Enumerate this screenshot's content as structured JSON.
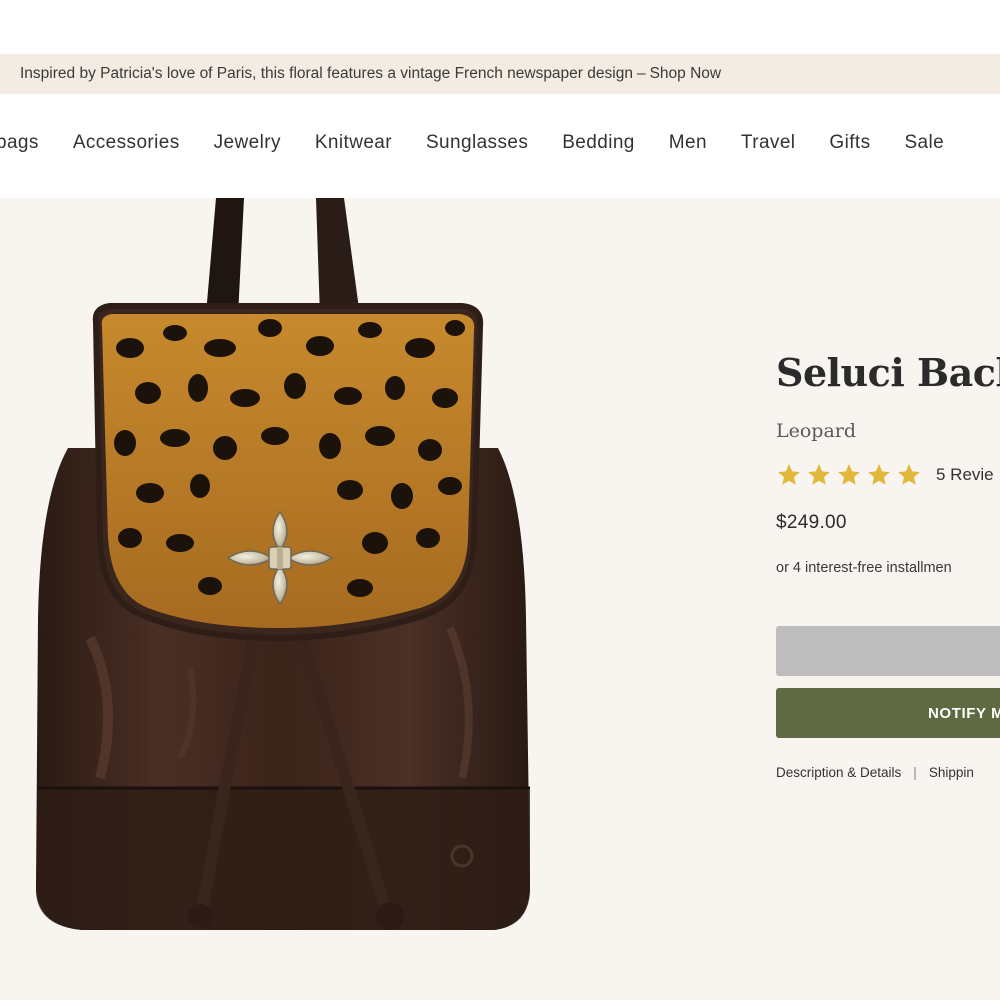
{
  "promo": {
    "text": "Inspired by Patricia's love of Paris, this floral features a vintage French newspaper design",
    "separator": "–",
    "link": "Shop Now"
  },
  "nav": {
    "items": [
      "bags",
      "Accessories",
      "Jewelry",
      "Knitwear",
      "Sunglasses",
      "Bedding",
      "Men",
      "Travel",
      "Gifts",
      "Sale"
    ]
  },
  "product": {
    "title": "Seluci Backpa",
    "variant": "Leopard",
    "rating": 5,
    "rating_max": 5,
    "review_label": "5 Revie",
    "price": "$249.00",
    "installments": "or 4 interest-free installmen",
    "notify_label": "NOTIFY M",
    "tabs": [
      "Description & Details",
      "Shippin"
    ],
    "tab_divider": "|"
  },
  "colors": {
    "star": "#e2b73a",
    "notify_button": "#5f6a42",
    "disabled_button": "#bdbdbd",
    "promo_bg": "#f3ece3",
    "stage_bg": "#f8f5f0"
  }
}
